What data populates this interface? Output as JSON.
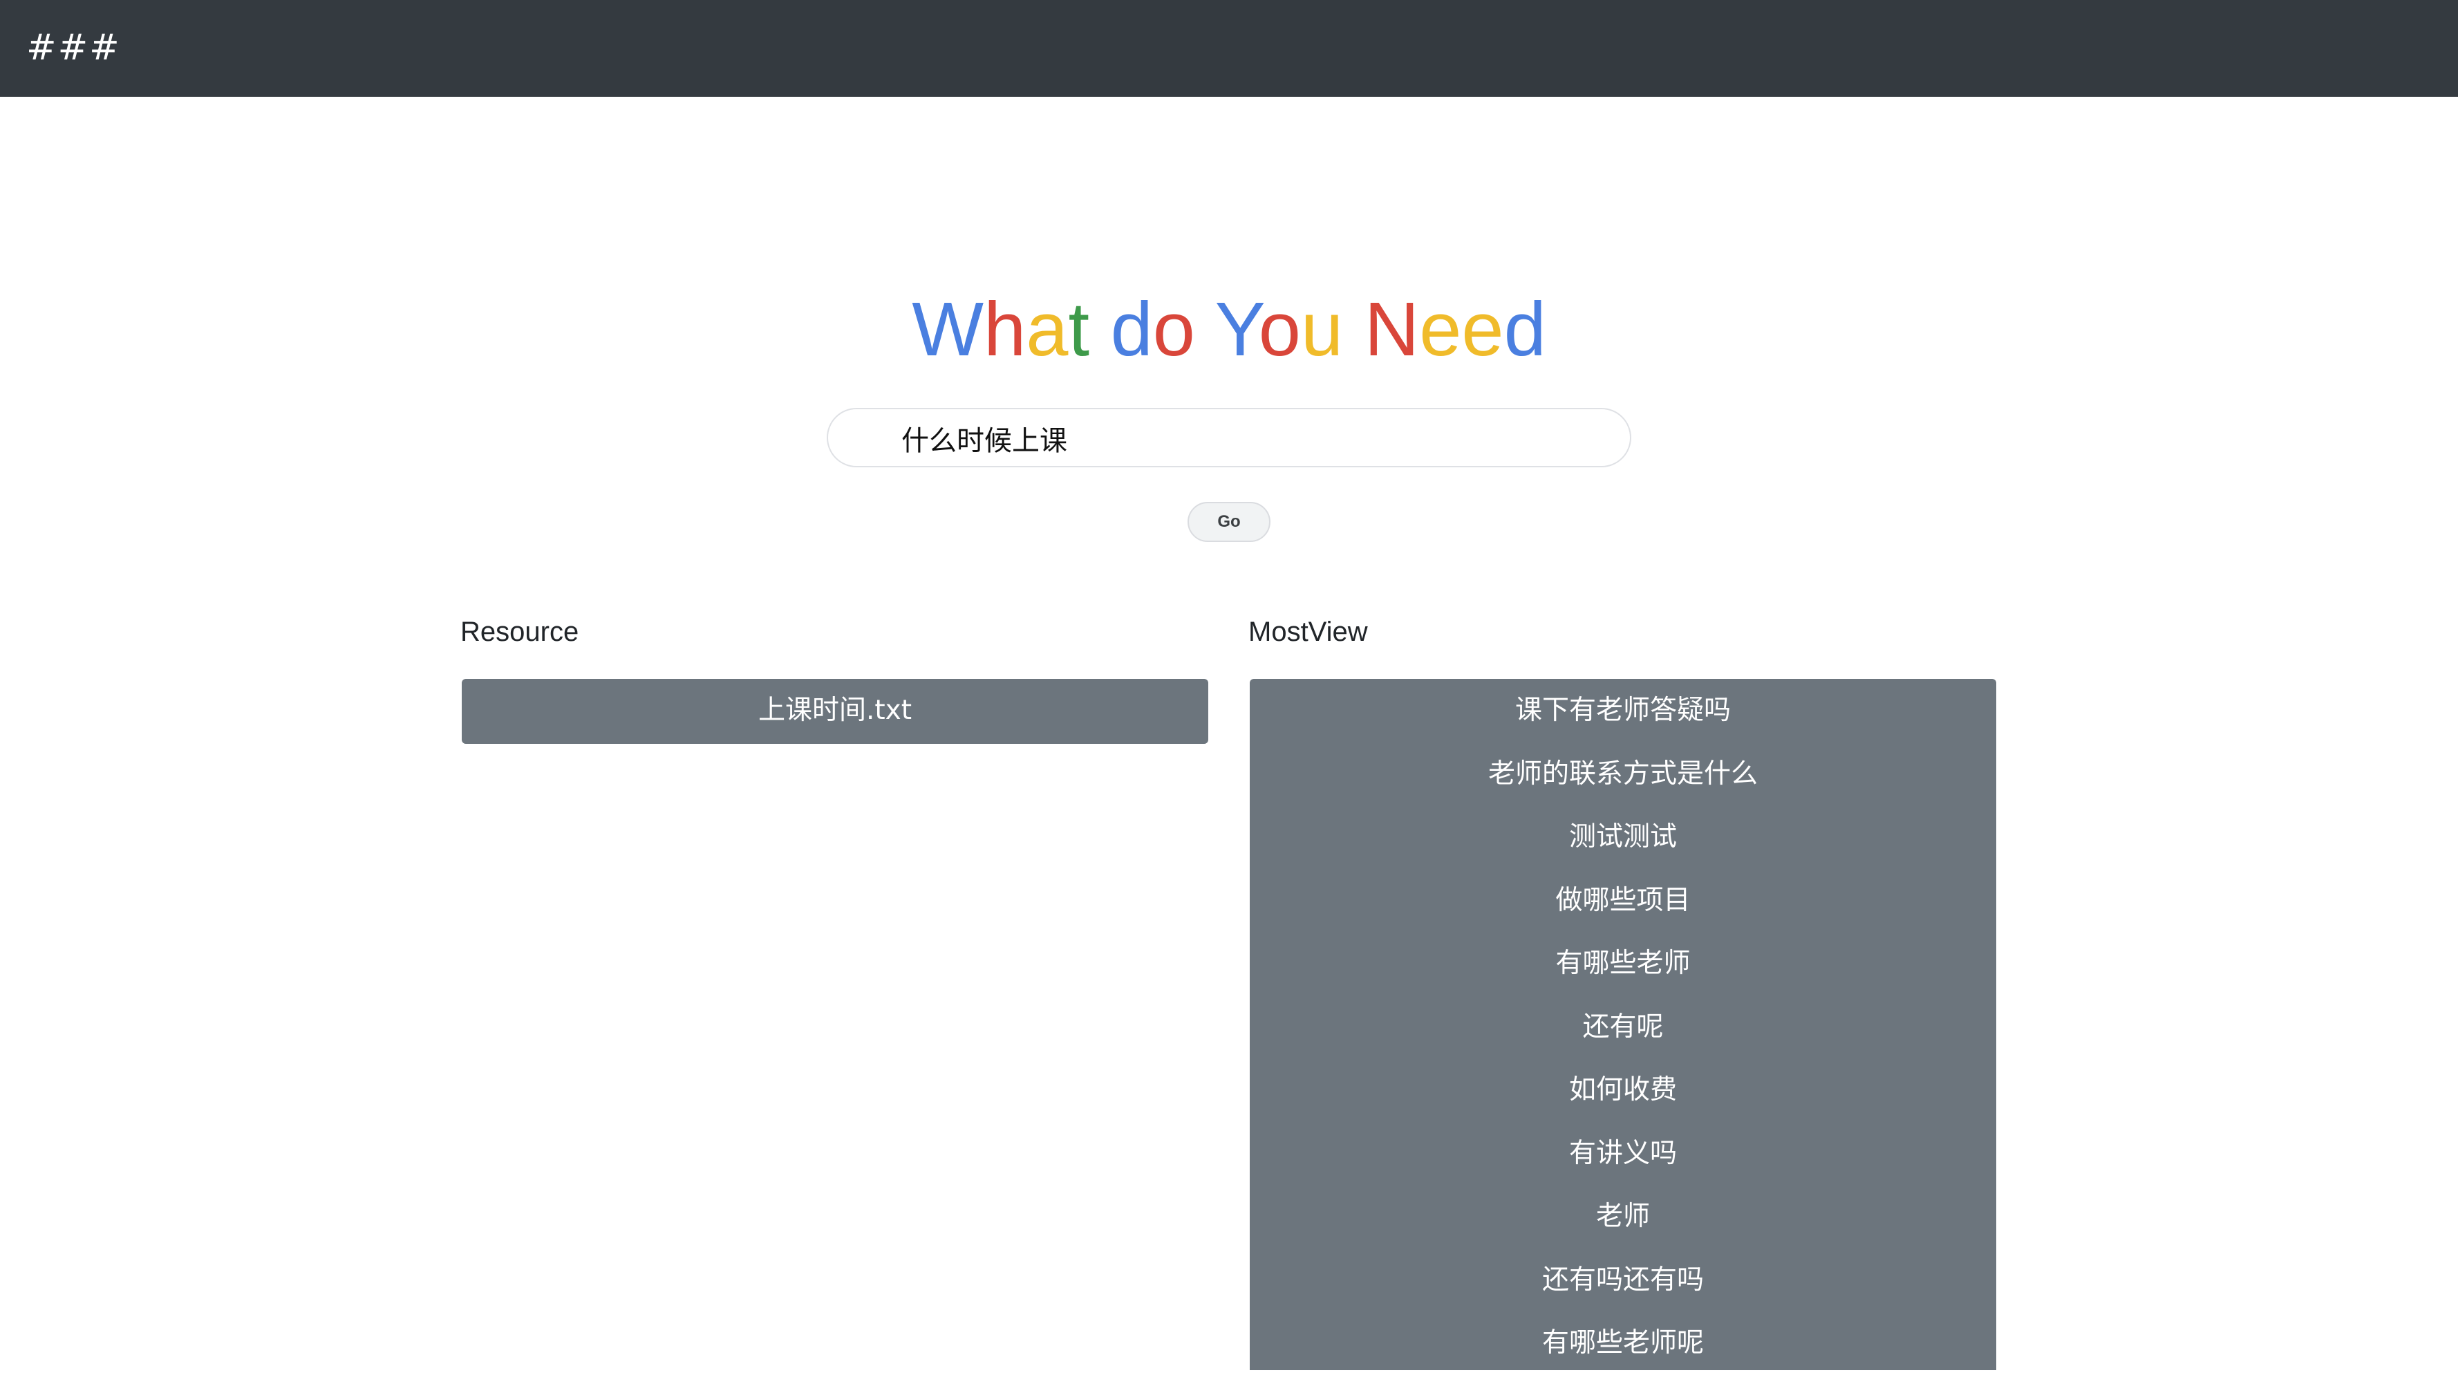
{
  "navbar": {
    "brand": "###"
  },
  "hero": {
    "title_letters": [
      {
        "char": "W",
        "color": "#4a7fe0"
      },
      {
        "char": "h",
        "color": "#d9463a"
      },
      {
        "char": "a",
        "color": "#f0bb2a"
      },
      {
        "char": "t",
        "color": "#3e9a4a"
      },
      {
        "char": " ",
        "color": "#000000"
      },
      {
        "char": "d",
        "color": "#4a7fe0"
      },
      {
        "char": "o",
        "color": "#d9463a"
      },
      {
        "char": " ",
        "color": "#000000"
      },
      {
        "char": "Y",
        "color": "#4a7fe0"
      },
      {
        "char": "o",
        "color": "#d9463a"
      },
      {
        "char": "u",
        "color": "#f0bb2a"
      },
      {
        "char": " ",
        "color": "#000000"
      },
      {
        "char": "N",
        "color": "#d9463a"
      },
      {
        "char": "e",
        "color": "#f0bb2a"
      },
      {
        "char": "e",
        "color": "#f0bb2a"
      },
      {
        "char": "d",
        "color": "#4a7fe0"
      }
    ]
  },
  "search": {
    "value": "什么时候上课",
    "button_label": "Go"
  },
  "resource": {
    "heading": "Resource",
    "items": [
      "上课时间.txt"
    ]
  },
  "mostview": {
    "heading": "MostView",
    "items": [
      "课下有老师答疑吗",
      "老师的联系方式是什么",
      "测试测试",
      "做哪些项目",
      "有哪些老师",
      "还有呢",
      "如何收费",
      "有讲义吗",
      "老师",
      "还有吗还有吗",
      "有哪些老师呢"
    ]
  },
  "colors": {
    "navbar_bg": "#343a40",
    "list_bg": "#6c757d"
  }
}
